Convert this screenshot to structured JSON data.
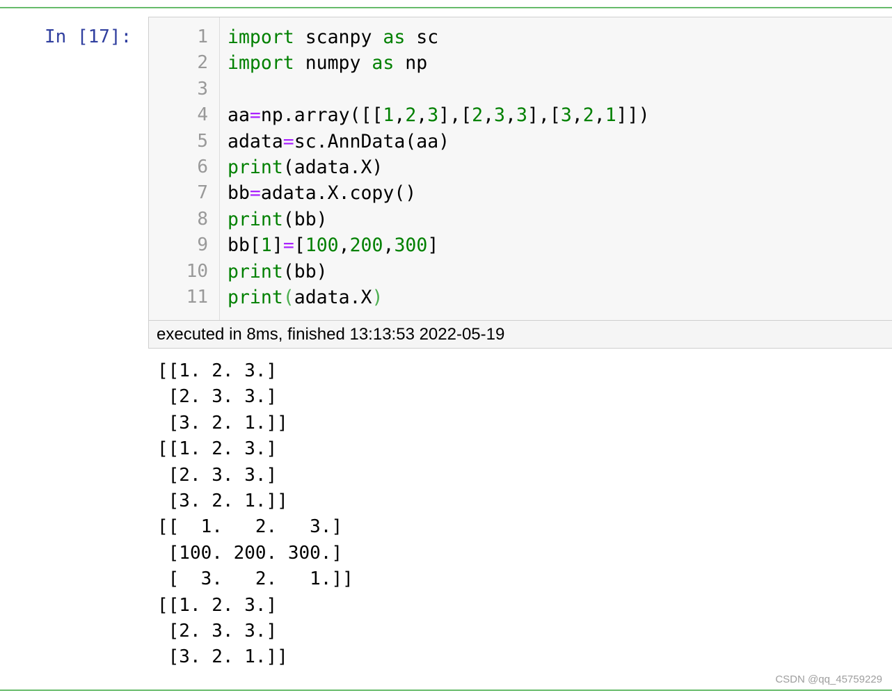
{
  "cell": {
    "prompt": "In [17]:",
    "line_numbers": [
      "1",
      "2",
      "3",
      "4",
      "5",
      "6",
      "7",
      "8",
      "9",
      "10",
      "11"
    ],
    "code": [
      [
        {
          "t": "import",
          "c": "kw"
        },
        {
          "t": " scanpy ",
          "c": ""
        },
        {
          "t": "as",
          "c": "kw"
        },
        {
          "t": " sc",
          "c": ""
        }
      ],
      [
        {
          "t": "import",
          "c": "kw"
        },
        {
          "t": " numpy ",
          "c": ""
        },
        {
          "t": "as",
          "c": "kw"
        },
        {
          "t": " np",
          "c": ""
        }
      ],
      [],
      [
        {
          "t": "aa",
          "c": ""
        },
        {
          "t": "=",
          "c": "op"
        },
        {
          "t": "np.array([[",
          "c": ""
        },
        {
          "t": "1",
          "c": "num"
        },
        {
          "t": ",",
          "c": ""
        },
        {
          "t": "2",
          "c": "num"
        },
        {
          "t": ",",
          "c": ""
        },
        {
          "t": "3",
          "c": "num"
        },
        {
          "t": "],[",
          "c": ""
        },
        {
          "t": "2",
          "c": "num"
        },
        {
          "t": ",",
          "c": ""
        },
        {
          "t": "3",
          "c": "num"
        },
        {
          "t": ",",
          "c": ""
        },
        {
          "t": "3",
          "c": "num"
        },
        {
          "t": "],[",
          "c": ""
        },
        {
          "t": "3",
          "c": "num"
        },
        {
          "t": ",",
          "c": ""
        },
        {
          "t": "2",
          "c": "num"
        },
        {
          "t": ",",
          "c": ""
        },
        {
          "t": "1",
          "c": "num"
        },
        {
          "t": "]])",
          "c": ""
        }
      ],
      [
        {
          "t": "adata",
          "c": ""
        },
        {
          "t": "=",
          "c": "op"
        },
        {
          "t": "sc.AnnData(aa)",
          "c": ""
        }
      ],
      [
        {
          "t": "print",
          "c": "bi"
        },
        {
          "t": "(adata.X)",
          "c": ""
        }
      ],
      [
        {
          "t": "bb",
          "c": ""
        },
        {
          "t": "=",
          "c": "op"
        },
        {
          "t": "adata.X.copy()",
          "c": ""
        }
      ],
      [
        {
          "t": "print",
          "c": "bi"
        },
        {
          "t": "(bb)",
          "c": ""
        }
      ],
      [
        {
          "t": "bb[",
          "c": ""
        },
        {
          "t": "1",
          "c": "num"
        },
        {
          "t": "]",
          "c": ""
        },
        {
          "t": "=",
          "c": "op"
        },
        {
          "t": "[",
          "c": ""
        },
        {
          "t": "100",
          "c": "num"
        },
        {
          "t": ",",
          "c": ""
        },
        {
          "t": "200",
          "c": "num"
        },
        {
          "t": ",",
          "c": ""
        },
        {
          "t": "300",
          "c": "num"
        },
        {
          "t": "]",
          "c": ""
        }
      ],
      [
        {
          "t": "print",
          "c": "bi"
        },
        {
          "t": "(bb)",
          "c": ""
        }
      ],
      [
        {
          "t": "print",
          "c": "bi"
        },
        {
          "t": "(",
          "c": "br-match"
        },
        {
          "t": "adata.X",
          "c": ""
        },
        {
          "t": ")",
          "c": "br-match"
        }
      ]
    ],
    "execution_status": "executed in 8ms, finished 13:13:53 2022-05-19",
    "output_lines": [
      "[[1. 2. 3.]",
      " [2. 3. 3.]",
      " [3. 2. 1.]]",
      "[[1. 2. 3.]",
      " [2. 3. 3.]",
      " [3. 2. 1.]]",
      "[[  1.   2.   3.]",
      " [100. 200. 300.]",
      " [  3.   2.   1.]]",
      "[[1. 2. 3.]",
      " [2. 3. 3.]",
      " [3. 2. 1.]]"
    ]
  },
  "watermark": "CSDN @qq_45759229",
  "colors": {
    "cell_border": "#66bb6a",
    "prompt": "#303f9f",
    "keyword": "#008000",
    "operator": "#aa22ff",
    "input_bg": "#f7f7f7"
  }
}
